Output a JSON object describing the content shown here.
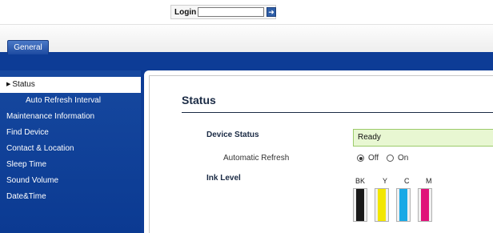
{
  "login": {
    "label": "Login",
    "value": "",
    "go_icon": "arrow-right-icon"
  },
  "tabs": [
    {
      "label": "General",
      "active": true
    }
  ],
  "sidebar": {
    "items": [
      {
        "label": "Status",
        "active": true,
        "sub": false
      },
      {
        "label": "Auto Refresh Interval",
        "active": false,
        "sub": true
      },
      {
        "label": "Maintenance Information",
        "active": false,
        "sub": false
      },
      {
        "label": "Find Device",
        "active": false,
        "sub": false
      },
      {
        "label": "Contact & Location",
        "active": false,
        "sub": false
      },
      {
        "label": "Sleep Time",
        "active": false,
        "sub": false
      },
      {
        "label": "Sound Volume",
        "active": false,
        "sub": false
      },
      {
        "label": "Date&Time",
        "active": false,
        "sub": false
      }
    ]
  },
  "main": {
    "title": "Status",
    "device_status_label": "Device Status",
    "device_status_value": "Ready",
    "auto_refresh_label": "Automatic Refresh",
    "auto_refresh_options": [
      "Off",
      "On"
    ],
    "auto_refresh_selected": "Off",
    "ink_level_label": "Ink Level",
    "inks": [
      {
        "name": "BK",
        "color": "#1a1a1a",
        "level": 1.0
      },
      {
        "name": "Y",
        "color": "#f2e600",
        "level": 1.0
      },
      {
        "name": "C",
        "color": "#19a9e6",
        "level": 1.0
      },
      {
        "name": "M",
        "color": "#e0127a",
        "level": 1.0
      }
    ]
  },
  "colors": {
    "nav_blue": "#0d3c96",
    "status_green_bg": "#e8f7d2"
  }
}
